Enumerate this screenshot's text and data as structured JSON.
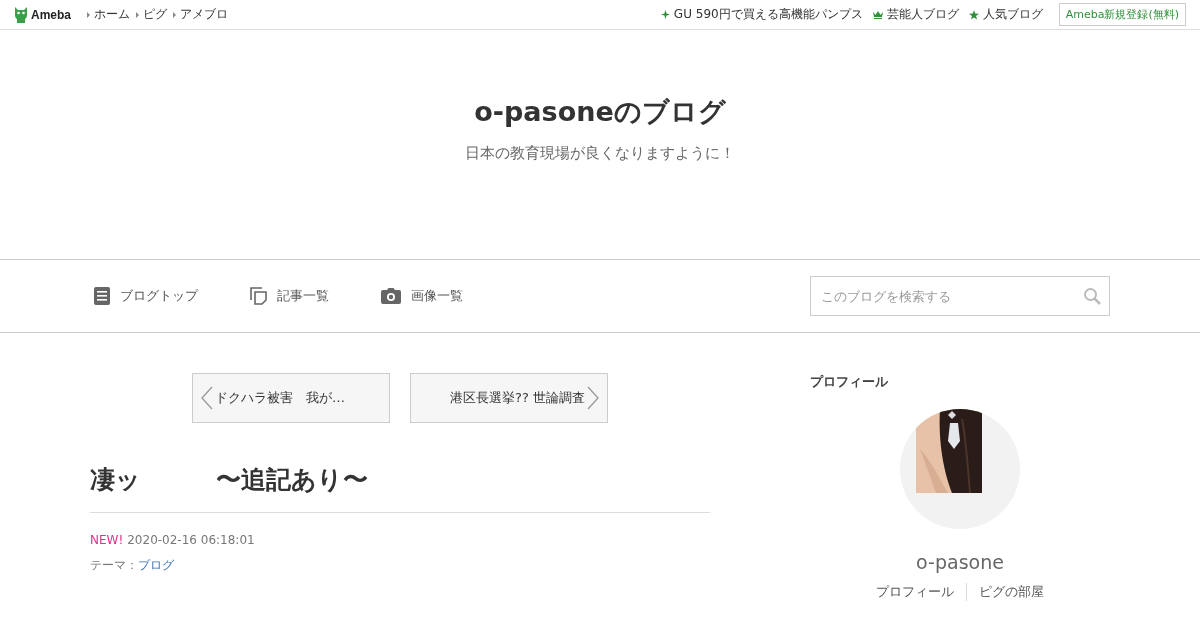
{
  "topbar": {
    "logo": "Ameba",
    "links": [
      "ホーム",
      "ピグ",
      "アメブロ"
    ],
    "promos": [
      {
        "kind": "sparkle",
        "label": "GU 590円で買える高機能パンプス"
      },
      {
        "kind": "crown",
        "label": "芸能人ブログ"
      },
      {
        "kind": "star",
        "label": "人気ブログ"
      }
    ],
    "register": "Ameba新規登録(無料)"
  },
  "blog": {
    "title": "o-pasoneのブログ",
    "subtitle": "日本の教育現場が良くなりますように！"
  },
  "nav": {
    "items": [
      {
        "kind": "document",
        "label": "ブログトップ"
      },
      {
        "kind": "pages",
        "label": "記事一覧"
      },
      {
        "kind": "camera",
        "label": "画像一覧"
      }
    ],
    "search": {
      "placeholder": "このブログを検索する"
    }
  },
  "pager": {
    "previous": "ドクハラ被害　我が…",
    "next": "港区長選挙?? 世論調査"
  },
  "article": {
    "title": "凄ッ　　　〜追記あり〜",
    "badge": "NEW!",
    "datetime": "2020-02-16 06:18:01",
    "theme_label": "テーマ：",
    "theme": "ブログ"
  },
  "sidebar": {
    "heading": "プロフィール",
    "avatar": {
      "kind": "picture"
    },
    "name": "o-pasone",
    "links": [
      "プロフィール",
      "ピグの部屋"
    ]
  }
}
